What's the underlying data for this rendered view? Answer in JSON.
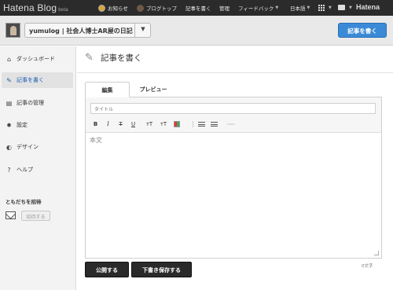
{
  "topbar": {
    "logo": "Hatena Blog",
    "logo_suffix": "beta",
    "nav": {
      "notice": "お知らせ",
      "blog_top": "ブログトップ",
      "write": "記事を書く",
      "manage": "管理",
      "feedback": "フィードバック",
      "language": "日本語"
    },
    "brand": "Hatena"
  },
  "blogbar": {
    "blog_name": "yumulog | 社会人博士AR屋の日記",
    "caret": "▼",
    "write_button": "記事を書く"
  },
  "sidebar": {
    "items": [
      {
        "label": "ダッシュボード",
        "icon": "home-icon",
        "active": false
      },
      {
        "label": "記事を書く",
        "icon": "pencil-icon",
        "active": true
      },
      {
        "label": "記事の管理",
        "icon": "document-icon",
        "active": false
      },
      {
        "label": "設定",
        "icon": "gear-icon",
        "active": false
      },
      {
        "label": "デザイン",
        "icon": "palette-icon",
        "active": false
      },
      {
        "label": "ヘルプ",
        "icon": "help-icon",
        "active": false
      }
    ],
    "invite_title": "ともだちを招待",
    "invite_button": "招待する"
  },
  "main": {
    "page_title": "記事を書く",
    "tabs": [
      "編集",
      "プレビュー"
    ],
    "title_placeholder": "タイトル",
    "toolbar": {
      "bold": "B",
      "italic": "I",
      "strike": "T",
      "underline": "U",
      "size_up": "тT",
      "size_down": "тT"
    },
    "body_placeholder": "本文",
    "char_count": "0文字",
    "publish_button": "公開する",
    "draft_button": "下書き保存する"
  },
  "colors": {
    "topbar_bg": "#2b2b2b",
    "accent_blue": "#3b8ad7",
    "dark_button": "#2a2a2a"
  }
}
